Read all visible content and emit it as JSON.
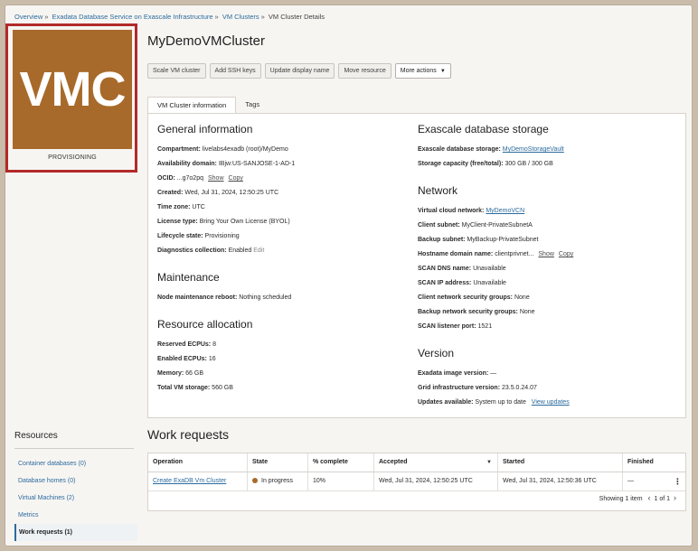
{
  "breadcrumb": {
    "items": [
      "Overview",
      "Exadata Database Service on Exascale Infrastructure",
      "VM Clusters",
      "VM Cluster Details"
    ],
    "separator": "»"
  },
  "resource": {
    "badge_text": "VMC",
    "badge_color": "#a86a2a",
    "state": "PROVISIONING",
    "title": "MyDemoVMCluster"
  },
  "actions": {
    "scale": "Scale VM cluster",
    "ssh": "Add SSH keys",
    "display": "Update display name",
    "move": "Move resource",
    "more": "More actions"
  },
  "tabs": [
    "VM Cluster information",
    "Tags"
  ],
  "general": {
    "heading": "General information",
    "compartment_label": "Compartment:",
    "compartment_value": "livelabs4exadb (root)/MyDemo",
    "ad_label": "Availability domain:",
    "ad_value": "IBjw:US-SANJOSE-1-AD-1",
    "ocid_label": "OCID:",
    "ocid_value": "...g7o2pq",
    "show": "Show",
    "copy": "Copy",
    "created_label": "Created:",
    "created_value": "Wed, Jul 31, 2024, 12:50:25 UTC",
    "tz_label": "Time zone:",
    "tz_value": "UTC",
    "license_label": "License type:",
    "license_value": "Bring Your Own License (BYOL)",
    "lifecycle_label": "Lifecycle state:",
    "lifecycle_value": "Provisioning",
    "diag_label": "Diagnostics collection:",
    "diag_value": "Enabled",
    "diag_edit": "Edit"
  },
  "maintenance": {
    "heading": "Maintenance",
    "reboot_label": "Node maintenance reboot:",
    "reboot_value": "Nothing scheduled"
  },
  "allocation": {
    "heading": "Resource allocation",
    "reserved_label": "Reserved ECPUs:",
    "reserved_value": "8",
    "enabled_label": "Enabled ECPUs:",
    "enabled_value": "16",
    "memory_label": "Memory:",
    "memory_value": "66 GB",
    "storage_label": "Total VM storage:",
    "storage_value": "560 GB"
  },
  "exascale": {
    "heading": "Exascale database storage",
    "storage_label": "Exascale database storage:",
    "storage_value": "MyDemoStorageVault",
    "capacity_label": "Storage capacity (free/total):",
    "capacity_value": "300 GB / 300 GB"
  },
  "network": {
    "heading": "Network",
    "vcn_label": "Virtual cloud network:",
    "vcn_value": "MyDemoVCN",
    "client_label": "Client subnet:",
    "client_value": "MyClient-PrivateSubnetA",
    "backup_label": "Backup subnet:",
    "backup_value": "MyBackup-PrivateSubnet",
    "hostname_label": "Hostname domain name:",
    "hostname_value": "clientprivnet...",
    "show": "Show",
    "copy": "Copy",
    "scan_dns_label": "SCAN DNS name:",
    "scan_dns_value": "Unavailable",
    "scan_ip_label": "SCAN IP address:",
    "scan_ip_value": "Unavailable",
    "cnsg_label": "Client network security groups:",
    "cnsg_value": "None",
    "bnsg_label": "Backup network security groups:",
    "bnsg_value": "None",
    "listener_label": "SCAN listener port:",
    "listener_value": "1521"
  },
  "version": {
    "heading": "Version",
    "image_label": "Exadata image version:",
    "image_value": "—",
    "grid_label": "Grid infrastructure version:",
    "grid_value": "23.5.0.24.07",
    "updates_label": "Updates available:",
    "updates_value": "System up to date",
    "view_updates": "View updates"
  },
  "resources_nav": {
    "heading": "Resources",
    "items": [
      "Container databases (0)",
      "Database homes (0)",
      "Virtual Machines (2)",
      "Metrics",
      "Work requests (1)"
    ]
  },
  "work_requests": {
    "heading": "Work requests",
    "columns": [
      "Operation",
      "State",
      "% complete",
      "Accepted",
      "Started",
      "Finished"
    ],
    "rows": [
      {
        "operation": "Create ExaDB Vm Cluster",
        "state": "In progress",
        "complete": "10%",
        "accepted": "Wed, Jul 31, 2024, 12:50:25 UTC",
        "started": "Wed, Jul 31, 2024, 12:50:36 UTC",
        "finished": "—"
      }
    ],
    "showing": "Showing 1 item",
    "pager": "1 of 1"
  }
}
